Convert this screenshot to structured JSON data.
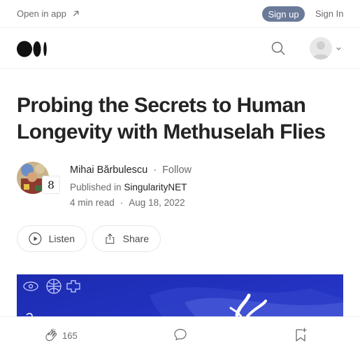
{
  "topbar": {
    "open_in_app": "Open in app",
    "sign_up": "Sign up",
    "sign_in": "Sign In"
  },
  "article": {
    "title": "Probing the Secrets to Human Longevity with Methuselah Flies",
    "author": "Mihai Bărbulescu",
    "follow": "Follow",
    "published_in_prefix": "Published in",
    "publication": "SingularityNET",
    "read_time": "4 min read",
    "date": "Aug 18, 2022",
    "separator": "·"
  },
  "actions": {
    "listen": "Listen",
    "share": "Share"
  },
  "bottom": {
    "claps": "165"
  },
  "colors": {
    "accent_signup": "#6b7a99",
    "hero_blue": "#1f2fae",
    "text": "#242424",
    "muted": "#6b6b6b"
  },
  "icons": [
    "arrow-up-right-icon",
    "medium-logo",
    "search-icon",
    "user-avatar-icon",
    "chevron-down-icon",
    "play-icon",
    "share-icon",
    "clap-icon",
    "comment-icon",
    "bookmark-icon"
  ]
}
